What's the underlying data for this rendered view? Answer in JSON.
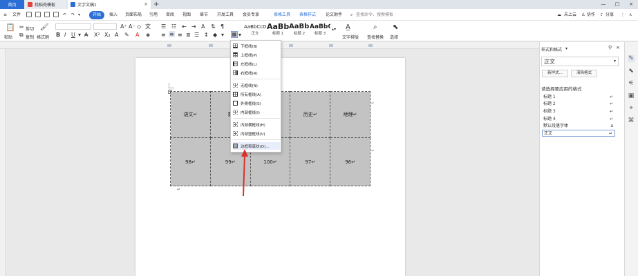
{
  "tabs": {
    "home": "首页",
    "template": "找稻壳模板",
    "document": "文字文稿1",
    "new_tab": "+"
  },
  "menu": {
    "file": "文件",
    "items": [
      "开始",
      "插入",
      "页面布局",
      "引用",
      "审阅",
      "视图",
      "章节",
      "开发工具",
      "会员专享"
    ],
    "context_tabs": [
      "表格工具",
      "表格样式"
    ],
    "paper": "论文助手",
    "search_placeholder": "查找命令、搜索模板",
    "cloud": "未上云",
    "collab": "协作",
    "share": "分享"
  },
  "ribbon": {
    "paste": "粘贴",
    "cut": "剪切",
    "copy": "复制",
    "format_painter": "格式刷",
    "styles": [
      {
        "preview": "AaBbCcD",
        "label": "正文"
      },
      {
        "preview": "AaBb",
        "label": "标题 1"
      },
      {
        "preview": "AaBb(",
        "label": "标题 2"
      },
      {
        "preview": "AaBbC",
        "label": "标题 3"
      }
    ],
    "text_layout": "文字排版",
    "find_replace": "查找替换",
    "select": "选择"
  },
  "table": {
    "row1": [
      "语文",
      "数",
      "",
      "历史",
      "地理"
    ],
    "row2": [
      "98",
      "99",
      "100",
      "97",
      "96"
    ]
  },
  "border_menu": {
    "items": [
      {
        "label": "下框线(B)"
      },
      {
        "label": "上框线(P)"
      },
      {
        "label": "左框线(L)"
      },
      {
        "label": "右框线(R)"
      },
      {
        "label": "无框线(N)"
      },
      {
        "label": "所有框线(A)"
      },
      {
        "label": "外侧框线(S)"
      },
      {
        "label": "内部框线(I)"
      },
      {
        "label": "内部横框线(H)"
      },
      {
        "label": "内部竖框线(V)"
      },
      {
        "label": "边框和底纹(O)..."
      }
    ]
  },
  "style_panel": {
    "title": "样式和格式",
    "current": "正文",
    "new_style": "新样式...",
    "clear_format": "清除格式",
    "prompt": "请选择要应用的格式",
    "list": [
      "标题 1",
      "标题 2",
      "标题 3",
      "标题 4",
      "默认段落字体",
      "正文"
    ]
  },
  "colors": {
    "accent": "#2b6fd6",
    "table_fill": "#c3c3c3",
    "arrow": "#d9302c"
  }
}
